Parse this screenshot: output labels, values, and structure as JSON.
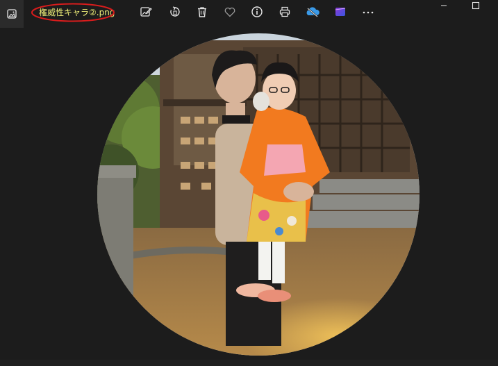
{
  "file": {
    "name": "権威性キャラ②.png"
  },
  "toolbar": {
    "icons": [
      "photos-app-icon",
      "edit-image-icon",
      "rotate-icon",
      "delete-icon",
      "favorite-icon",
      "info-icon",
      "print-icon",
      "onedrive-icon",
      "clipchamp-icon",
      "more-icon"
    ]
  },
  "colors": {
    "background": "#1c1c1c",
    "filename_text": "#f2f27a",
    "annotation": "#d91c1c",
    "icon": "#e8e8e8"
  }
}
